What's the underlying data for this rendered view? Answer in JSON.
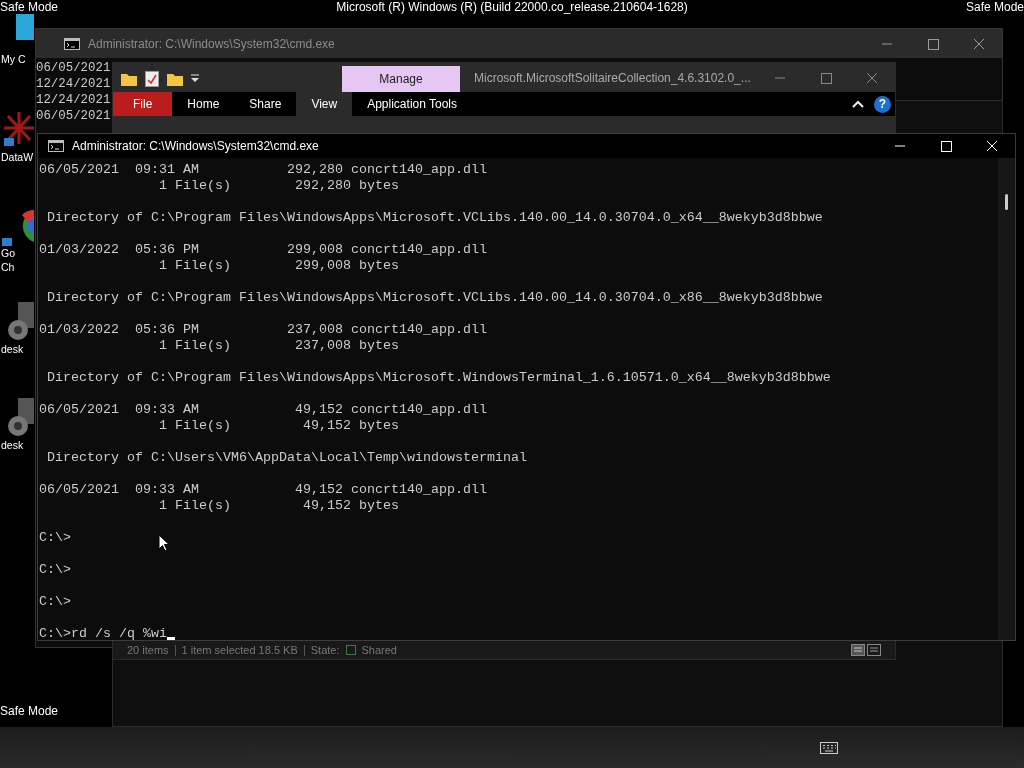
{
  "top_bar": {
    "left": "Safe Mode",
    "center": "Microsoft (R) Windows (R) (Build 22000.co_release.210604-1628)",
    "right": "Safe Mode"
  },
  "desktop_icons": [
    {
      "kind": "monitor",
      "label": "My C"
    },
    {
      "kind": "app",
      "label": "DataW"
    },
    {
      "kind": "browser",
      "label": "Go\nCh"
    },
    {
      "kind": "gear",
      "label": "desk"
    },
    {
      "kind": "gear",
      "label": "desk"
    }
  ],
  "bottom_label": "Safe Mode",
  "back_console": {
    "title": "Administrator: C:\\Windows\\System32\\cmd.exe",
    "lines": [
      "06/05/2021",
      "12/24/2021",
      "12/24/2021",
      "06/05/2021"
    ]
  },
  "explorer": {
    "title": "Microsoft.MicrosoftSolitaireCollection_4.6.3102.0_...",
    "context_tab": "Manage",
    "tabs": [
      {
        "label": "File",
        "kind": "file",
        "selected": false
      },
      {
        "label": "Home",
        "kind": "tab",
        "selected": false
      },
      {
        "label": "Share",
        "kind": "tab",
        "selected": false
      },
      {
        "label": "View",
        "kind": "tab",
        "selected": true
      },
      {
        "label": "Application Tools",
        "kind": "tab",
        "selected": false
      }
    ],
    "help": "?",
    "status_bar": [
      "20 items",
      "1 item selected  18.5 KB",
      "State:",
      "Shared"
    ]
  },
  "console": {
    "title": "Administrator: C:\\Windows\\System32\\cmd.exe",
    "cursor": true,
    "blocks": [
      [
        "06/05/2021  09:31 AM           292,280 concrt140_app.dll",
        "               1 File(s)        292,280 bytes"
      ],
      [
        " Directory of C:\\Program Files\\WindowsApps\\Microsoft.VCLibs.140.00_14.0.30704.0_x64__8wekyb3d8bbwe"
      ],
      [
        "01/03/2022  05:36 PM           299,008 concrt140_app.dll",
        "               1 File(s)        299,008 bytes"
      ],
      [
        " Directory of C:\\Program Files\\WindowsApps\\Microsoft.VCLibs.140.00_14.0.30704.0_x86__8wekyb3d8bbwe"
      ],
      [
        "01/03/2022  05:36 PM           237,008 concrt140_app.dll",
        "               1 File(s)        237,008 bytes"
      ],
      [
        " Directory of C:\\Program Files\\WindowsApps\\Microsoft.WindowsTerminal_1.6.10571.0_x64__8wekyb3d8bbwe"
      ],
      [
        "06/05/2021  09:33 AM            49,152 concrt140_app.dll",
        "               1 File(s)         49,152 bytes"
      ],
      [
        " Directory of C:\\Users\\VM6\\AppData\\Local\\Temp\\windowsterminal"
      ],
      [
        "06/05/2021  09:33 AM            49,152 concrt140_app.dll",
        "               1 File(s)         49,152 bytes"
      ],
      [
        "C:\\>"
      ],
      [
        "C:\\>"
      ],
      [
        "C:\\>"
      ],
      [
        "C:\\>rd /s /q %wi"
      ]
    ]
  }
}
